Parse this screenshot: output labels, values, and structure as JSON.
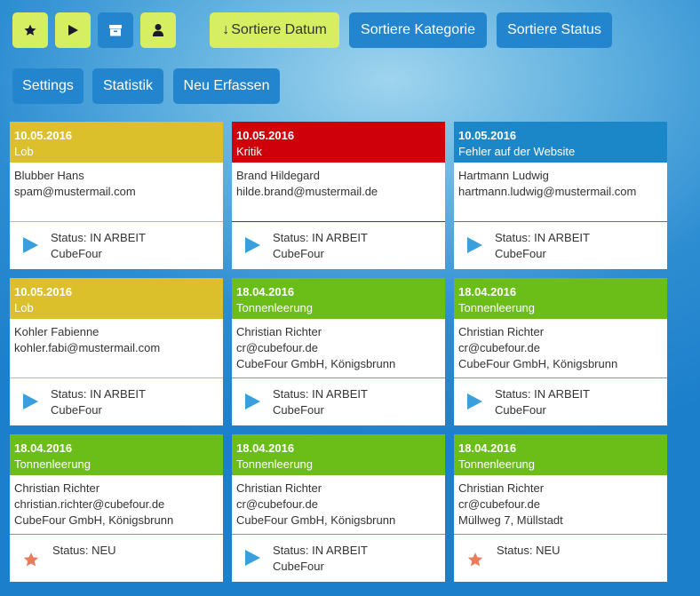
{
  "colors": {
    "lob": "#dbbf2b",
    "kritik": "#d0000a",
    "fehler": "#1b87c9",
    "tonnen": "#6abe17",
    "lime_button": "#d6ee62",
    "blue_button": "#2285cd",
    "play_icon": "#3a9fdc",
    "star_icon": "#ea7c5c"
  },
  "toolbar": {
    "star_icon": "star-icon",
    "play_icon": "play-icon",
    "archive_icon": "archive-icon",
    "user_icon": "user-icon",
    "sort_date_arrow": "↓",
    "sort_date_label": "Sortiere Datum",
    "sort_category_label": "Sortiere Kategorie",
    "sort_status_label": "Sortiere Status"
  },
  "menu": {
    "settings_label": "Settings",
    "statistics_label": "Statistik",
    "new_label": "Neu Erfassen"
  },
  "cards": [
    {
      "date": "10.05.2016",
      "category": "Lob",
      "color": "lob",
      "name": "Blubber Hans",
      "email": "spam@mustermail.com",
      "address": "",
      "status_icon": "play-icon",
      "status": "Status: IN ARBEIT",
      "company": "CubeFour",
      "line": "#dbbf2b"
    },
    {
      "date": "10.05.2016",
      "category": "Kritik",
      "color": "kritik",
      "name": "Brand Hildegard",
      "email": "hilde.brand@mustermail.de",
      "address": "",
      "status_icon": "play-icon",
      "status": "Status: IN ARBEIT",
      "company": "CubeFour",
      "line": "#d0000a"
    },
    {
      "date": "10.05.2016",
      "category": "Fehler auf der Website",
      "color": "fehler",
      "name": "Hartmann Ludwig",
      "email": "hartmann.ludwig@mustermail.com",
      "address": "",
      "status_icon": "play-icon",
      "status": "Status: IN ARBEIT",
      "company": "CubeFour",
      "line": "#1b87c9"
    },
    {
      "date": "10.05.2016",
      "category": "Lob",
      "color": "lob",
      "name": "Kohler Fabienne",
      "email": "kohler.fabi@mustermail.com",
      "address": "",
      "status_icon": "play-icon",
      "status": "Status: IN ARBEIT",
      "company": "CubeFour",
      "line": "#dbbf2b"
    },
    {
      "date": "18.04.2016",
      "category": "Tonnenleerung",
      "color": "tonnen",
      "name": "Christian Richter",
      "email": "cr@cubefour.de",
      "address": "CubeFour GmbH, Königsbrunn",
      "status_icon": "play-icon",
      "status": "Status: IN ARBEIT",
      "company": "CubeFour",
      "line": "#6abe17"
    },
    {
      "date": "18.04.2016",
      "category": "Tonnenleerung",
      "color": "tonnen",
      "name": "Christian Richter",
      "email": "cr@cubefour.de",
      "address": "CubeFour GmbH, Königsbrunn",
      "status_icon": "play-icon",
      "status": "Status: IN ARBEIT",
      "company": "CubeFour",
      "line": "#6abe17"
    },
    {
      "date": "18.04.2016",
      "category": "Tonnenleerung",
      "color": "tonnen",
      "name": "Christian Richter",
      "email": "christian.richter@cubefour.de",
      "address": "CubeFour GmbH, Königsbrunn",
      "status_icon": "star-icon",
      "status": "Status: NEU",
      "company": "",
      "line": "#6abe17"
    },
    {
      "date": "18.04.2016",
      "category": "Tonnenleerung",
      "color": "tonnen",
      "name": "Christian Richter",
      "email": "cr@cubefour.de",
      "address": "CubeFour GmbH, Königsbrunn",
      "status_icon": "play-icon",
      "status": "Status: IN ARBEIT",
      "company": "CubeFour",
      "line": "#6abe17"
    },
    {
      "date": "18.04.2016",
      "category": "Tonnenleerung",
      "color": "tonnen",
      "name": "Christian Richter",
      "email": "cr@cubefour.de",
      "address": "Müllweg 7, Müllstadt",
      "status_icon": "star-icon",
      "status": "Status: NEU",
      "company": "",
      "line": "#6abe17"
    }
  ]
}
